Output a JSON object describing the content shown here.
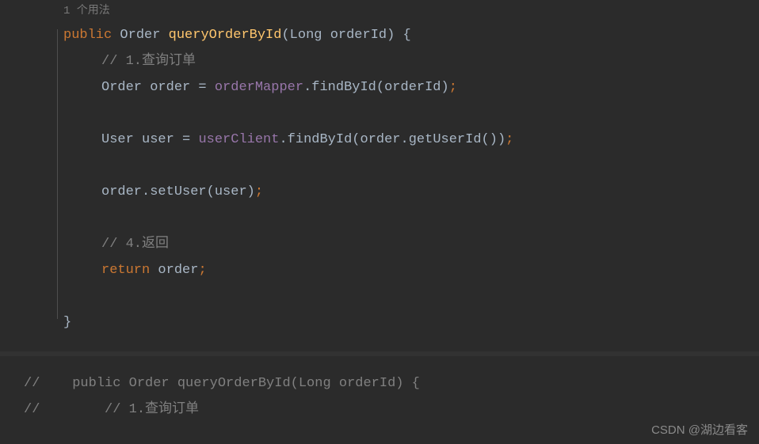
{
  "hint": {
    "usages": "1 个用法"
  },
  "code": {
    "line1": {
      "kw_public": "public",
      "type": "Order",
      "method": "queryOrderById",
      "param_type": "Long",
      "param_name": "orderId",
      "brace": " {"
    },
    "line2": {
      "comment": "// 1.",
      "comment_cn": "查询订单"
    },
    "line3": {
      "type": "Order",
      "var": "order",
      "eq": " = ",
      "field": "orderMapper",
      "dot": ".",
      "method": "findById",
      "arg": "orderId"
    },
    "line4": {
      "type": "User",
      "var": "user",
      "eq": " = ",
      "field": "userClient",
      "dot": ".",
      "method": "findById",
      "arg_obj": "order",
      "arg_method": "getUserId"
    },
    "line5": {
      "obj": "order",
      "method": "setUser",
      "arg": "user"
    },
    "line6": {
      "comment": "// 4.",
      "comment_cn": "返回"
    },
    "line7": {
      "kw_return": "return",
      "var": "order"
    },
    "line8": {
      "brace": "}"
    },
    "commented1": "//    public Order queryOrderById(Long orderId) {",
    "commented2_prefix": "//        // 1.",
    "commented2_cn": "查询订单"
  },
  "watermark": "CSDN @湖边看客"
}
